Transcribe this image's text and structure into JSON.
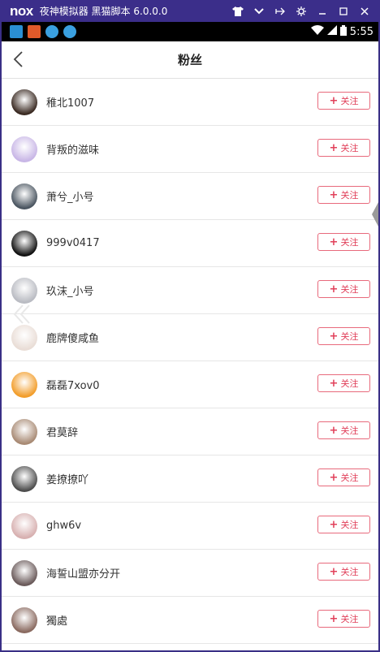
{
  "window": {
    "logo": "nox",
    "title": "夜神模拟器 黑猫脚本 6.0.0.0",
    "controls": [
      "shirt-icon",
      "dropdown-icon",
      "pin-icon",
      "settings-icon",
      "minimize-icon",
      "maximize-icon",
      "close-icon"
    ]
  },
  "statusbar": {
    "time": "5:55",
    "icons": [
      "keyhole-app-icon",
      "game-app-icon",
      "browser-app-icon",
      "browser-app-icon"
    ]
  },
  "nav": {
    "title": "粉丝",
    "back_icon": "chevron-left-icon"
  },
  "follow_label": "关注",
  "fans": [
    {
      "name": "稚北1007",
      "avatar": "#3a2a22"
    },
    {
      "name": "背叛的滋味",
      "avatar": "#c8b6e6"
    },
    {
      "name": "萧兮_小号",
      "avatar": "#4a5560"
    },
    {
      "name": "999v0417",
      "avatar": "#111111"
    },
    {
      "name": "玖沫_小号",
      "avatar": "#b9bbc2"
    },
    {
      "name": "鹿牌傻咸鱼",
      "avatar": "#e9ddd6"
    },
    {
      "name": "磊磊7xov0",
      "avatar": "#f29d2a"
    },
    {
      "name": "君莫辞",
      "avatar": "#a88a74"
    },
    {
      "name": "姜撩撩吖",
      "avatar": "#4d4d4d"
    },
    {
      "name": "ghw6v",
      "avatar": "#d7b0b0"
    },
    {
      "name": "海誓山盟亦分开",
      "avatar": "#6a5a5a"
    },
    {
      "name": "獨處",
      "avatar": "#8a6a60"
    }
  ],
  "colors": {
    "accent": "#e1405a",
    "titlebar": "#3b2e8a"
  }
}
